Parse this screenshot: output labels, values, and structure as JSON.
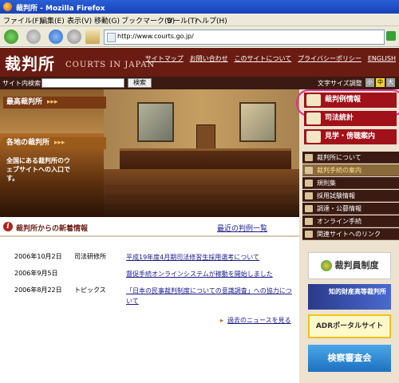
{
  "window": {
    "title": "裁判所 - Mozilla Firefox"
  },
  "menu": [
    "ファイル(F)",
    "編集(E)",
    "表示(V)",
    "移動(G)",
    "ブックマーク(B)",
    "ツール(T)",
    "ヘルプ(H)"
  ],
  "nav": {
    "url": "http://www.courts.go.jp/"
  },
  "site": {
    "logo_jp": "裁判所",
    "logo_en": "COURTS IN JAPAN",
    "top_links": [
      "サイトマップ",
      "お問い合わせ",
      "このサイトについて",
      "プライバシーポリシー",
      "ENGLISH"
    ],
    "search_label": "サイト内検索",
    "search_button": "検索",
    "font_size_label": "文字サイズ調整",
    "font_sizes": [
      "小",
      "中",
      "大"
    ]
  },
  "hero": {
    "supreme_court": "最高裁判所",
    "local_courts": "各地の裁判所",
    "description": "全国にある裁判所のウェブサイトへの入口です。"
  },
  "sidebar": {
    "main_buttons": [
      "裁判例情報",
      "司法統計",
      "見学・傍聴案内"
    ],
    "links": [
      "裁判所について",
      "裁判手続の案内",
      "規則集",
      "採用試験情報",
      "調達・公募情報",
      "オンライン手続",
      "関連サイトへのリンク"
    ],
    "banners": [
      "裁判員制度",
      "知的財産高等裁判所",
      "ADRポータルサイト",
      "検察審査会"
    ]
  },
  "news": {
    "heading": "裁判所からの新着情報",
    "recent_cases_link": "最近の判例一覧",
    "items": [
      {
        "date": "2006年10月2日",
        "category": "司法研修所",
        "title": "平成19年度4月期司法修習生採用選考について"
      },
      {
        "date": "2006年9月5日",
        "category": "",
        "title": "督促手続オンラインシステムが稼動を開始しました"
      },
      {
        "date": "2006年8月22日",
        "category": "トピックス",
        "title": "「日本の民事裁判制度についての意識調査」への協力について"
      }
    ],
    "past_news_link": "過去のニュースを見る"
  },
  "colors": {
    "brand": "#6b1c12",
    "accent_red": "#a0111a",
    "highlight_ring": "#e0308c",
    "link": "#1a1a8a"
  }
}
